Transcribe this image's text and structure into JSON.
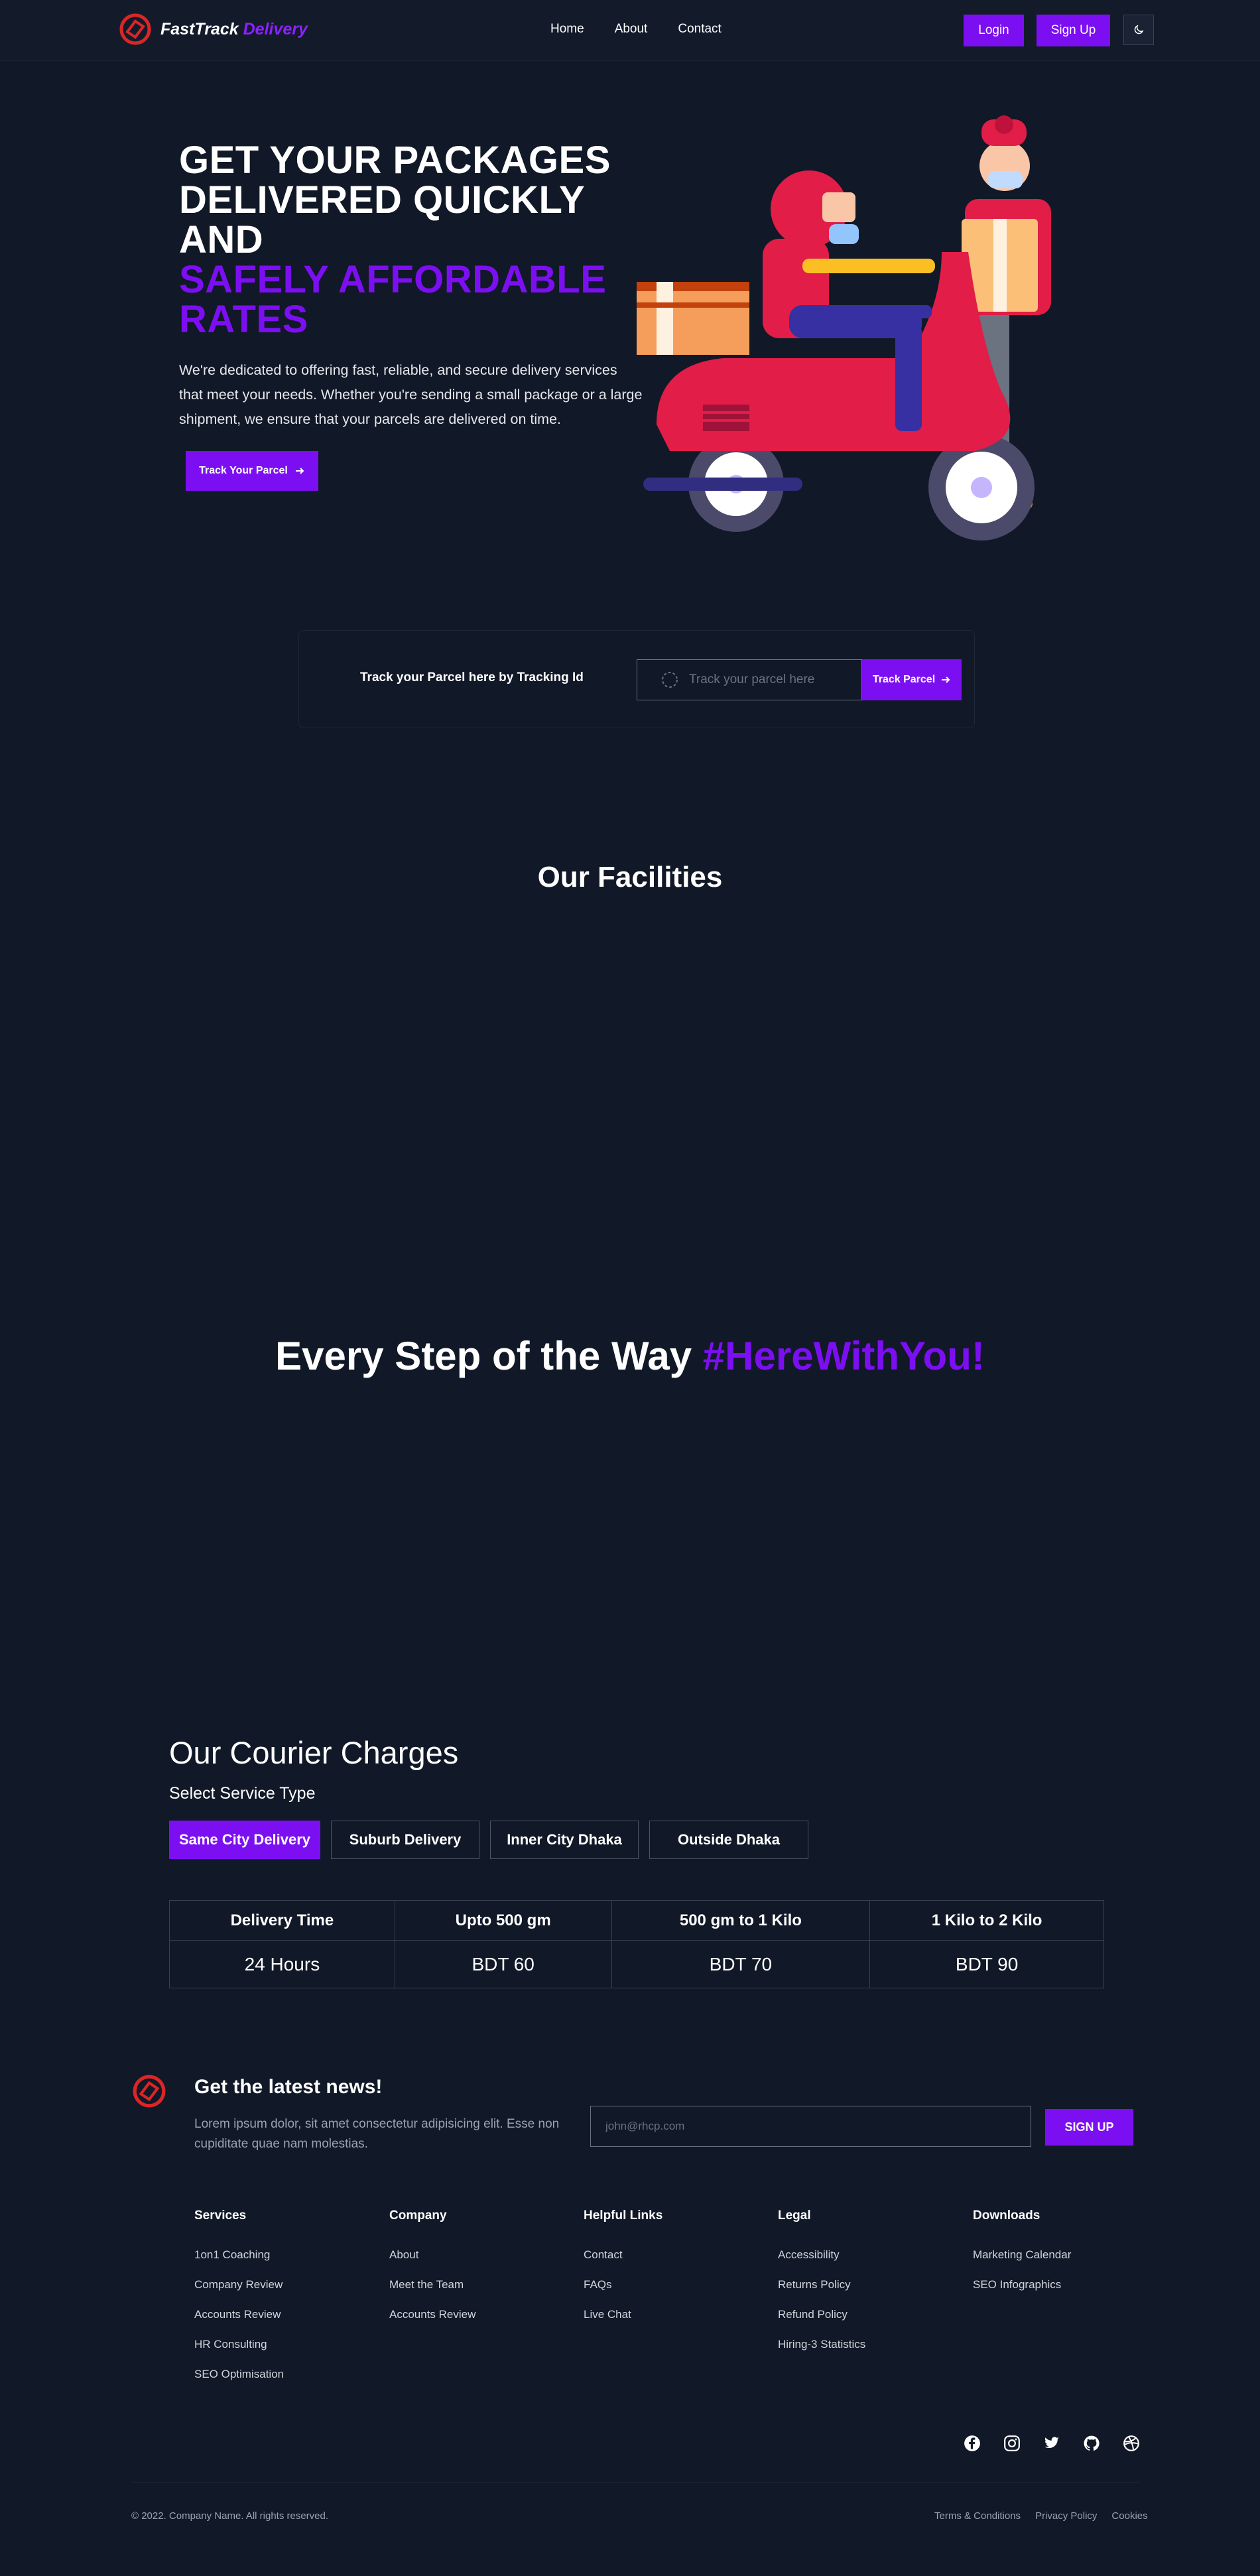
{
  "nav": {
    "logo_prefix": "FastTrack",
    "logo_accent": "Delivery",
    "links": [
      "Home",
      "About",
      "Contact"
    ],
    "login": "Login",
    "signup": "Sign Up"
  },
  "hero": {
    "title_line1": "GET YOUR PACKAGES",
    "title_line2": "DELIVERED QUICKLY",
    "title_line3": "AND",
    "title_accent1": "SAFELY AFFORDABLE",
    "title_accent2": "RATES",
    "description": "We're dedicated to offering fast, reliable, and secure delivery services that meet your needs. Whether you're sending a small package or a large shipment, we ensure that your parcels are delivered on time.",
    "cta": "Track Your Parcel"
  },
  "tracking": {
    "label": "Track your Parcel here by Tracking Id",
    "placeholder": "Track your parcel here",
    "button": "Track Parcel"
  },
  "facilities": {
    "title": "Our Facilities"
  },
  "every_step": {
    "text": "Every Step of the Way",
    "hashtag": "#HereWithYou!"
  },
  "courier": {
    "title": "Our Courier Charges",
    "select_label": "Select Service Type",
    "tabs": [
      "Same City Delivery",
      "Suburb Delivery",
      "Inner City Dhaka",
      "Outside Dhaka"
    ],
    "active_tab": "Same City Delivery",
    "table": {
      "headers": [
        "Delivery Time",
        "Upto 500 gm",
        "500 gm to 1 Kilo",
        "1 Kilo to 2 Kilo"
      ],
      "row": [
        "24 Hours",
        "BDT 60",
        "BDT 70",
        "BDT 90"
      ]
    }
  },
  "newsletter": {
    "title": "Get the latest news!",
    "description": "Lorem ipsum dolor, sit amet consectetur adipisicing elit. Esse non cupiditate quae nam molestias.",
    "placeholder": "john@rhcp.com",
    "button": "SIGN UP"
  },
  "footer": {
    "columns": [
      {
        "title": "Services",
        "items": [
          "1on1 Coaching",
          "Company Review",
          "Accounts Review",
          "HR Consulting",
          "SEO Optimisation"
        ]
      },
      {
        "title": "Company",
        "items": [
          "About",
          "Meet the Team",
          "Accounts Review"
        ]
      },
      {
        "title": "Helpful Links",
        "items": [
          "Contact",
          "FAQs",
          "Live Chat"
        ]
      },
      {
        "title": "Legal",
        "items": [
          "Accessibility",
          "Returns Policy",
          "Refund Policy",
          "Hiring-3 Statistics"
        ]
      },
      {
        "title": "Downloads",
        "items": [
          "Marketing Calendar",
          "SEO Infographics"
        ]
      }
    ],
    "socials": [
      "facebook-icon",
      "instagram-icon",
      "twitter-icon",
      "github-icon",
      "dribbble-icon"
    ],
    "copyright": "© 2022. Company Name. All rights reserved.",
    "legal_links": [
      "Terms & Conditions",
      "Privacy Policy",
      "Cookies"
    ]
  },
  "colors": {
    "accent": "#7c0ff2",
    "background": "#111827",
    "logo_red": "#dc2626"
  }
}
